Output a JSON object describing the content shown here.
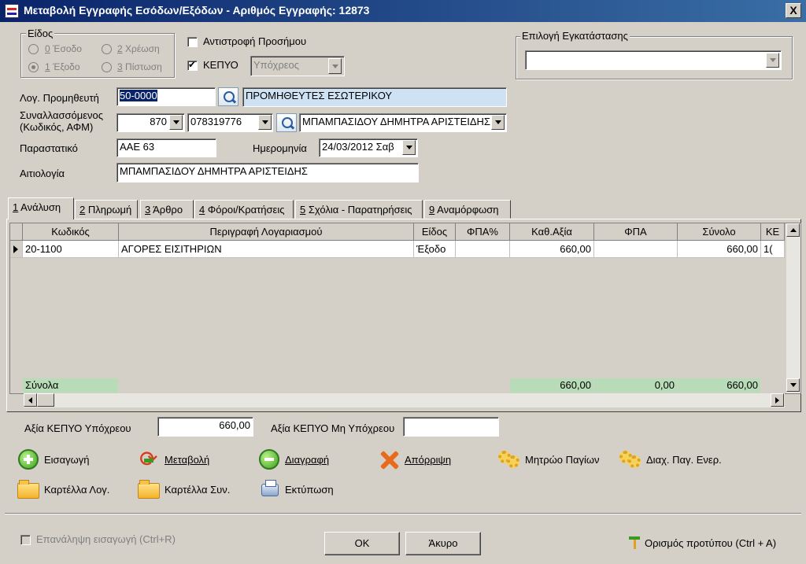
{
  "window": {
    "title": "Μεταβολή Εγγραφής Εσόδων/Εξόδων - Αριθμός Εγγραφής: 12873",
    "close": "X"
  },
  "eidos": {
    "legend": "Είδος",
    "options": [
      {
        "key": "0",
        "label": "Έσοδο"
      },
      {
        "key": "2",
        "label": "Χρέωση"
      },
      {
        "key": "1",
        "label": "Έξοδο"
      },
      {
        "key": "3",
        "label": "Πίστωση"
      }
    ],
    "selected": "Έξοδο"
  },
  "reverse_sign": {
    "label": "Αντιστροφή Προσήμου",
    "checked": false
  },
  "kepyo": {
    "label": "ΚΕΠΥΟ",
    "checked": true,
    "value": "Υπόχρεος"
  },
  "installation": {
    "legend": "Επιλογή Εγκατάστασης",
    "value": ""
  },
  "supplier": {
    "label": "Λογ. Προμηθευτή",
    "code": "50-0000",
    "name": "ΠΡΟΜΗΘΕΥΤΕΣ ΕΣΩΤΕΡΙΚΟΥ"
  },
  "counterparty": {
    "label1": "Συναλλασσόμενος",
    "label2": "(Κωδικός, ΑΦΜ)",
    "code": "870",
    "afm": "078319776",
    "name": "ΜΠΑΜΠΑΣΙΔΟΥ  ΔΗΜΗΤΡΑ ΑΡΙΣΤΕΙΔΗΣ"
  },
  "document": {
    "label": "Παραστατικό",
    "value": "ΑΑΕ 63"
  },
  "date": {
    "label": "Ημερομηνία",
    "value": "24/03/2012 Σαβ"
  },
  "justification": {
    "label": "Αιτιολογία",
    "value": "ΜΠΑΜΠΑΣΙΔΟΥ  ΔΗΜΗΤΡΑ ΑΡΙΣΤΕΙΔΗΣ"
  },
  "tabs": [
    {
      "key": "1",
      "label": " Ανάλυση"
    },
    {
      "key": "2",
      "label": " Πληρωμή"
    },
    {
      "key": "3",
      "label": " Άρθρο"
    },
    {
      "key": "4",
      "label": " Φόροι/Κρατήσεις"
    },
    {
      "key": "5",
      "label": " Σχόλια - Παρατηρήσεις"
    },
    {
      "key": "9",
      "label": " Αναμόρφωση"
    }
  ],
  "grid": {
    "columns": [
      "Κωδικός",
      "Περιγραφή Λογαριασμού",
      "Είδος",
      "ΦΠΑ%",
      "Καθ.Αξία",
      "ΦΠΑ",
      "Σύνολο",
      "ΚΕ"
    ],
    "rows": [
      [
        "20-1100",
        "ΑΓΟΡΕΣ ΕΙΣΙΤΗΡΙΩΝ",
        "Έξοδο",
        "",
        "660,00",
        "",
        "660,00",
        "1("
      ]
    ],
    "totals": {
      "label": "Σύνολα",
      "net": "660,00",
      "vat": "0,00",
      "total": "660,00"
    }
  },
  "kepyo_values": {
    "liable_label": "Αξία ΚΕΠΥΟ Υπόχρεου",
    "liable_value": "660,00",
    "non_liable_label": "Αξία ΚΕΠΥΟ Μη Υπόχρεου",
    "non_liable_value": ""
  },
  "actions": {
    "insert": "Εισαγωγή",
    "modify": "Μεταβολή",
    "delete": "Διαγραφή",
    "reject": "Απόρριψη",
    "asset_registry": "Μητρώο Παγίων",
    "asset_manage": "Διαχ. Παγ. Ενερ.",
    "account_card": "Καρτέλλα Λογ.",
    "party_card": "Καρτέλλα Συν.",
    "print": "Εκτύπωση"
  },
  "footer": {
    "repeat_label": "Επανάληψη εισαγωγή (Ctrl+R)",
    "ok": "OK",
    "cancel": "Άκυρο",
    "template": "Ορισμός προτύπου (Ctrl + A)"
  }
}
